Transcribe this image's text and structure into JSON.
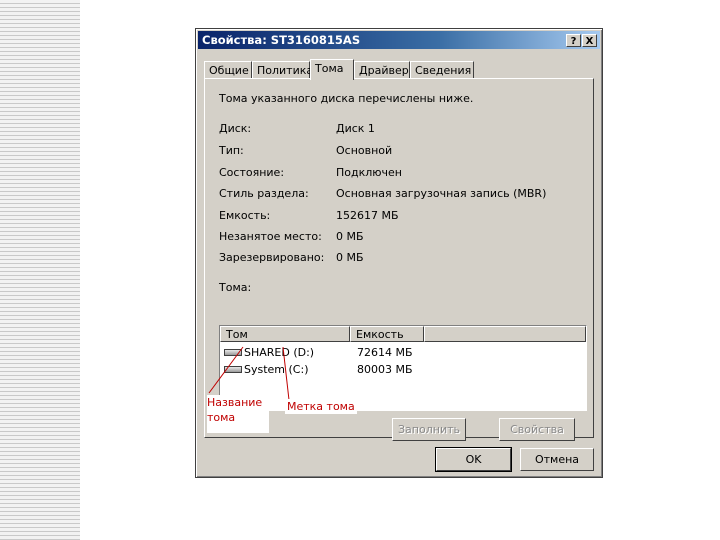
{
  "window": {
    "title": "Свойства: ST3160815AS",
    "help_btn": "?",
    "close_btn": "X"
  },
  "tabs": [
    "Общие",
    "Политика",
    "Тома",
    "Драйвер",
    "Сведения"
  ],
  "active_tab": "Тома",
  "panel": {
    "description": "Тома указанного диска перечислены ниже.",
    "props": [
      {
        "label": "Диск:",
        "value": "Диск 1"
      },
      {
        "label": "Тип:",
        "value": "Основной"
      },
      {
        "label": "Состояние:",
        "value": "Подключен"
      },
      {
        "label": "Стиль раздела:",
        "value": "Основная загрузочная запись (MBR)"
      },
      {
        "label": "Емкость:",
        "value": "152617 МБ"
      },
      {
        "label": "Незанятое место:",
        "value": "0 МБ"
      },
      {
        "label": "Зарезервировано:",
        "value": "0 МБ"
      }
    ],
    "volumes_label": "Тома:",
    "columns": [
      "Том",
      "Емкость"
    ],
    "rows": [
      {
        "name": "SHARED (D:)",
        "size": "72614 МБ"
      },
      {
        "name": "System (C:)",
        "size": "80003 МБ"
      }
    ],
    "populate_btn": "Заполнить",
    "properties_btn": "Свойства"
  },
  "buttons": {
    "ok": "OK",
    "cancel": "Отмена"
  },
  "callouts": {
    "volume_name": "Название тома",
    "volume_label": "Метка тома"
  }
}
